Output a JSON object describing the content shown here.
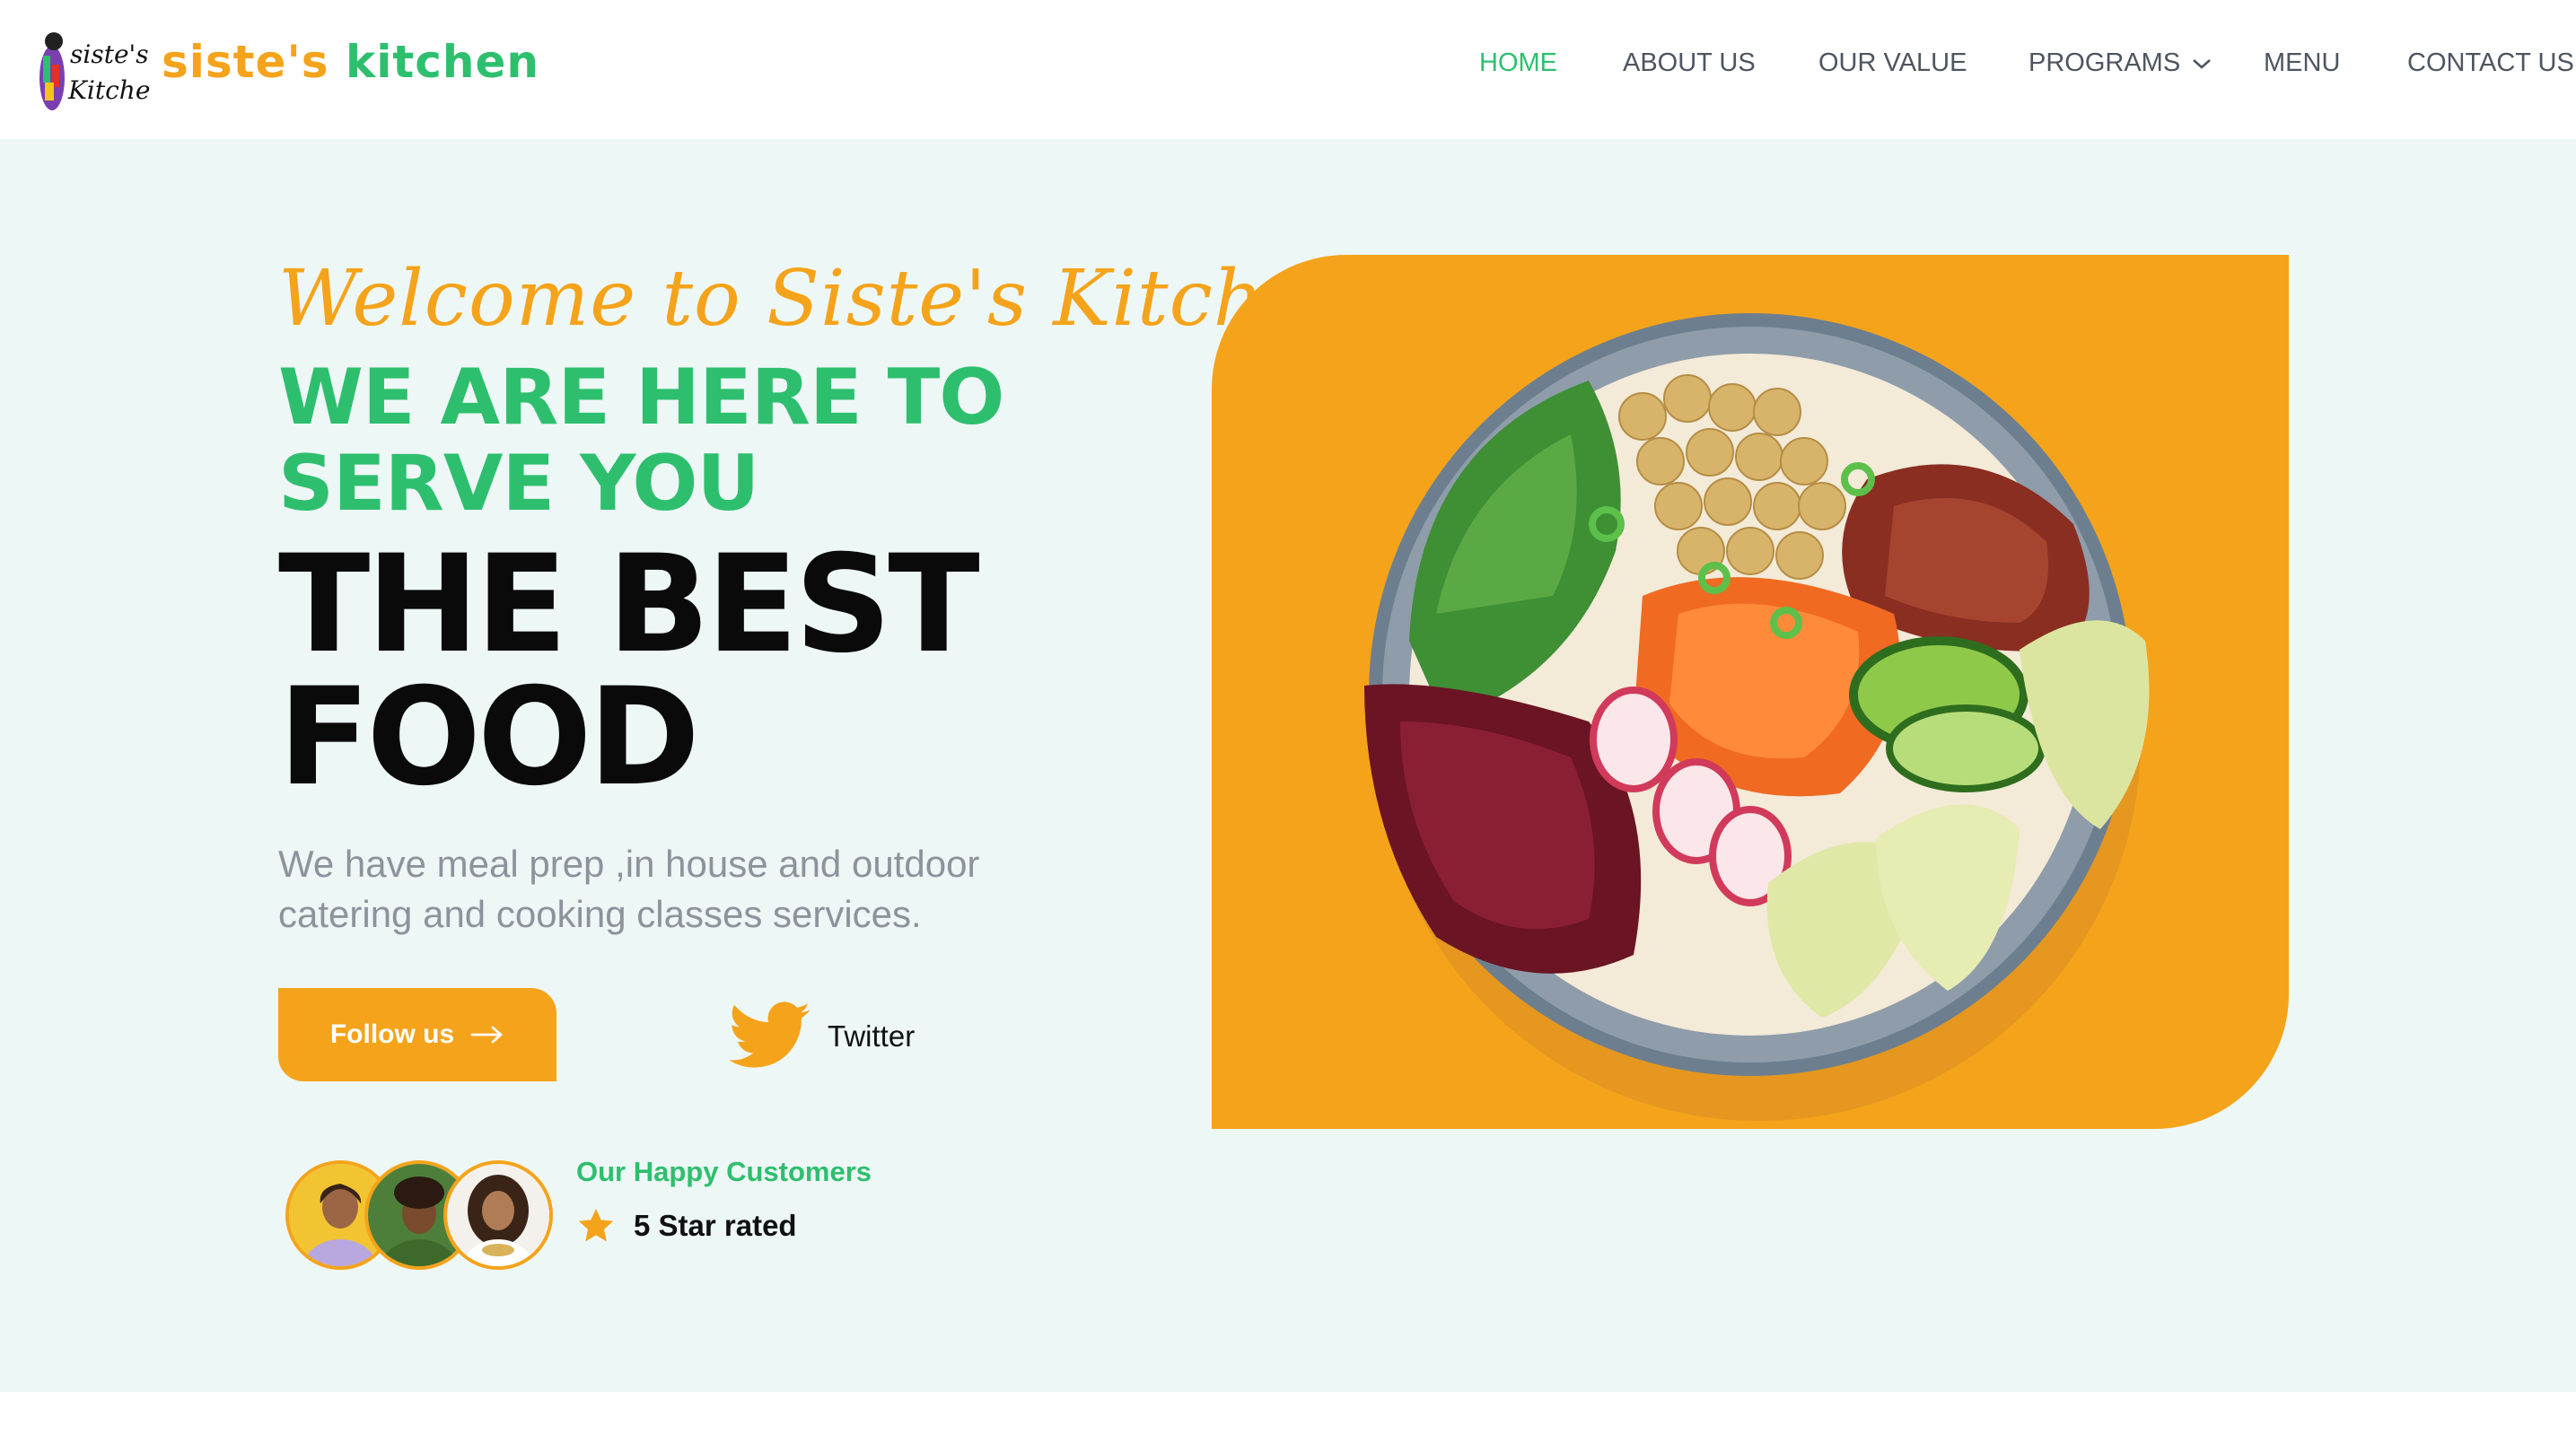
{
  "brand": {
    "logo_mark_line1": "siste's",
    "logo_mark_line2": "Kitchen",
    "name_part1": "siste's",
    "name_part2": "kitchen"
  },
  "nav": {
    "items": [
      {
        "label": "HOME",
        "active": true
      },
      {
        "label": "ABOUT US"
      },
      {
        "label": "OUR VALUE"
      },
      {
        "label": "PROGRAMS",
        "has_dropdown": true
      },
      {
        "label": "MENU"
      },
      {
        "label": "CONTACT US"
      }
    ]
  },
  "hero": {
    "welcome": "Welcome to Siste's Kitchen",
    "tagline": "WE ARE HERE TO SERVE YOU",
    "headline": "THE BEST FOOD",
    "description": "We have meal prep ,in house and outdoor catering and cooking classes services.",
    "follow_button": "Follow us",
    "twitter_label": "Twitter",
    "customers_title": "Our Happy Customers",
    "rating_label": "5 Star rated"
  },
  "colors": {
    "accent_orange": "#f5a31a",
    "accent_green": "#2ebf6e",
    "hero_bg": "#edf7f6",
    "nav_text": "#4d5560"
  },
  "icons": [
    "chevron-down-icon",
    "arrow-right-icon",
    "twitter-bird-icon",
    "star-icon"
  ]
}
